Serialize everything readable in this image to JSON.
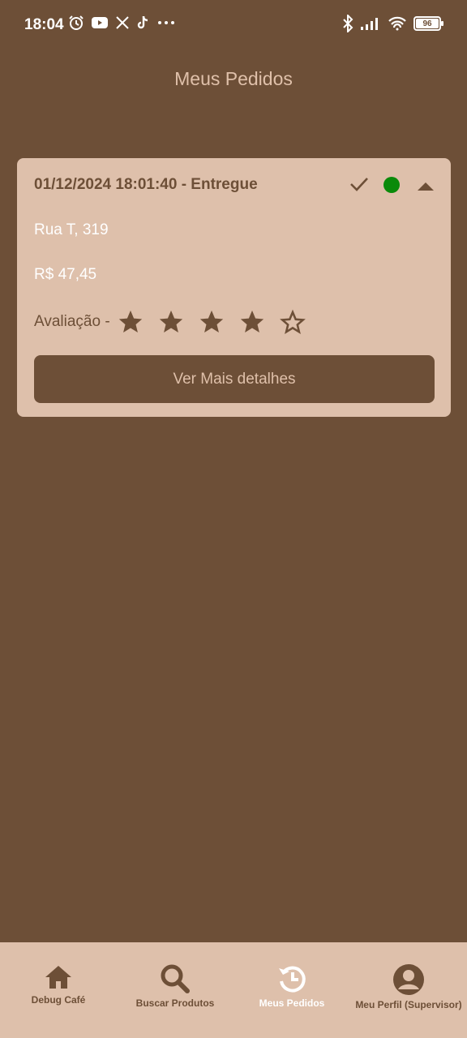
{
  "status_bar": {
    "time": "18:04",
    "battery": "96",
    "left_icons": [
      "alarm-icon",
      "youtube-icon",
      "x-icon",
      "tiktok-icon",
      "more-dots-icon"
    ],
    "right_icons": [
      "bluetooth-icon",
      "signal-icon",
      "wifi-icon",
      "battery-icon"
    ]
  },
  "header": {
    "title": "Meus Pedidos"
  },
  "order": {
    "header": "01/12/2024 18:01:40 - Entregue",
    "address": "Rua T, 319",
    "total": "R$ 47,45",
    "rating_label": "Avaliação -",
    "rating": 4,
    "rating_max": 5,
    "status_color": "#0a8a0a",
    "details_button": "Ver Mais detalhes"
  },
  "nav": {
    "items": [
      {
        "label": "Debug Café",
        "icon": "home-icon",
        "active": false
      },
      {
        "label": "Buscar Produtos",
        "icon": "search-icon",
        "active": false
      },
      {
        "label": "Meus Pedidos",
        "icon": "history-icon",
        "active": true
      },
      {
        "label": "Meu Perfil (Supervisor)",
        "icon": "profile-icon",
        "active": false
      }
    ]
  },
  "colors": {
    "background": "#6d4f37",
    "card": "#dec0ab",
    "accent_text": "#dfc0aa"
  }
}
